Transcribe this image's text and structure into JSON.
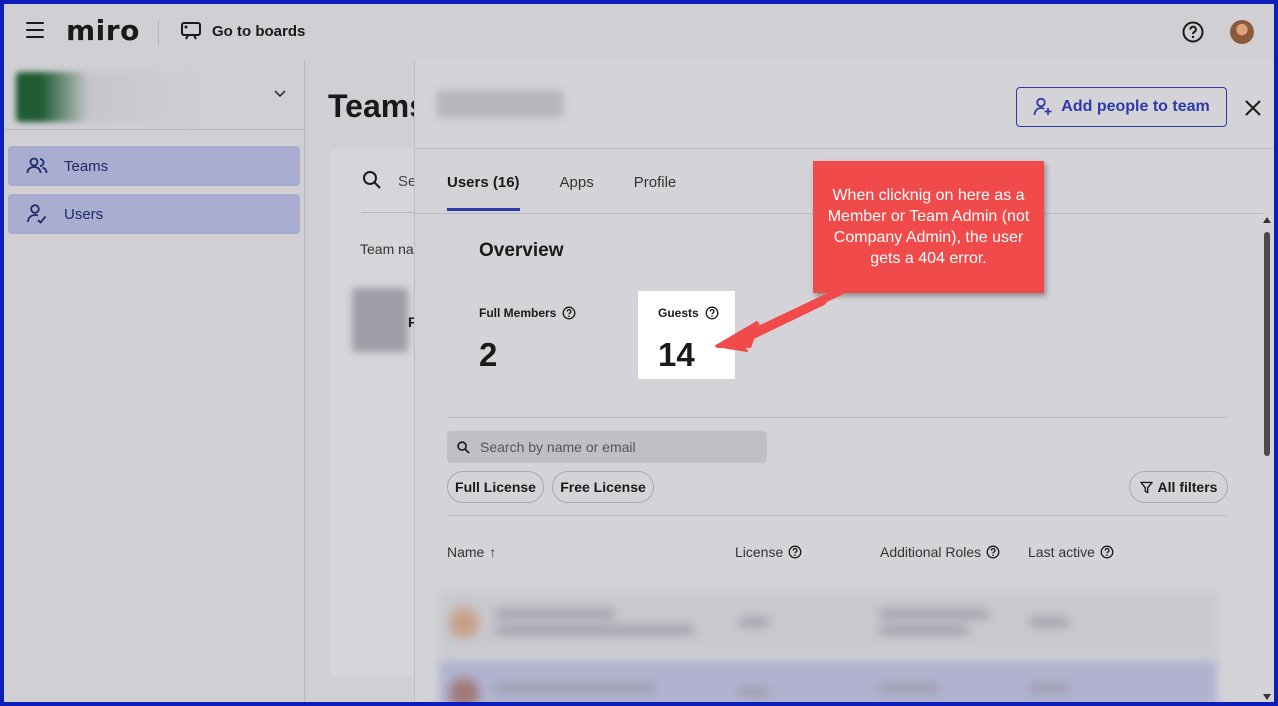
{
  "app": {
    "logo": "miro",
    "go_to_boards": "Go to boards"
  },
  "sidebar": {
    "items": [
      {
        "label": "Teams"
      },
      {
        "label": "Users"
      }
    ]
  },
  "main": {
    "title": "Teams",
    "search_placeholder": "Se",
    "column_team_name": "Team na",
    "row_letter": "F"
  },
  "panel": {
    "add_button": "Add people to team",
    "tabs": [
      {
        "label": "Users (16)",
        "active": true
      },
      {
        "label": "Apps",
        "active": false
      },
      {
        "label": "Profile",
        "active": false
      }
    ],
    "overview_title": "Overview",
    "stats": {
      "full_members_label": "Full Members",
      "full_members_value": "2",
      "guests_label": "Guests",
      "guests_value": "14"
    },
    "search_placeholder": "Search by name or email",
    "chips": [
      "Full License",
      "Free License"
    ],
    "all_filters": "All filters",
    "columns": {
      "name": "Name",
      "name_sort": "↑",
      "license": "License",
      "roles": "Additional Roles",
      "last_active": "Last active"
    }
  },
  "annotation": {
    "text": "When clicknig on here as a Member or Team Admin (not Company Admin), the user gets a 404 error.",
    "color": "#f04a4a"
  },
  "colors": {
    "accent": "#2e3aa8",
    "border": "#0b1fb8"
  }
}
